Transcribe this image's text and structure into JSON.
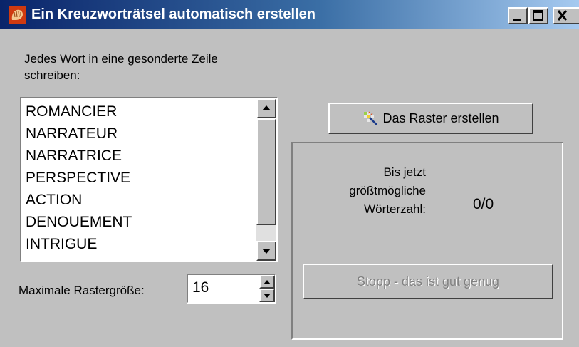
{
  "window": {
    "title": "Ein Kreuzworträtsel automatisch erstellen",
    "controls": [
      "minimize",
      "maximize",
      "close"
    ]
  },
  "instructions": {
    "line1": "Jedes Wort in eine gesonderte Zeile",
    "line2": "schreiben:"
  },
  "word_list": {
    "items": [
      "ROMANCIER",
      "NARRATEUR",
      "NARRATRICE",
      "PERSPECTIVE",
      "ACTION",
      "DENOUEMENT",
      "INTRIGUE"
    ]
  },
  "grid_size": {
    "label": "Maximale Rastergröße:",
    "value": "16"
  },
  "create_button": {
    "label": "Das Raster erstellen",
    "icon": "magic-wand-icon"
  },
  "status": {
    "label_line1": "Bis jetzt",
    "label_line2": "größtmögliche",
    "label_line3": "Wörterzahl:",
    "value": "0/0"
  },
  "stop_button": {
    "label": "Stopp - das ist gut genug",
    "enabled": false
  },
  "colors": {
    "face": "#c0c0c0",
    "title_start": "#0a246a",
    "title_end": "#a6caf0",
    "disabled_text": "#808080"
  }
}
